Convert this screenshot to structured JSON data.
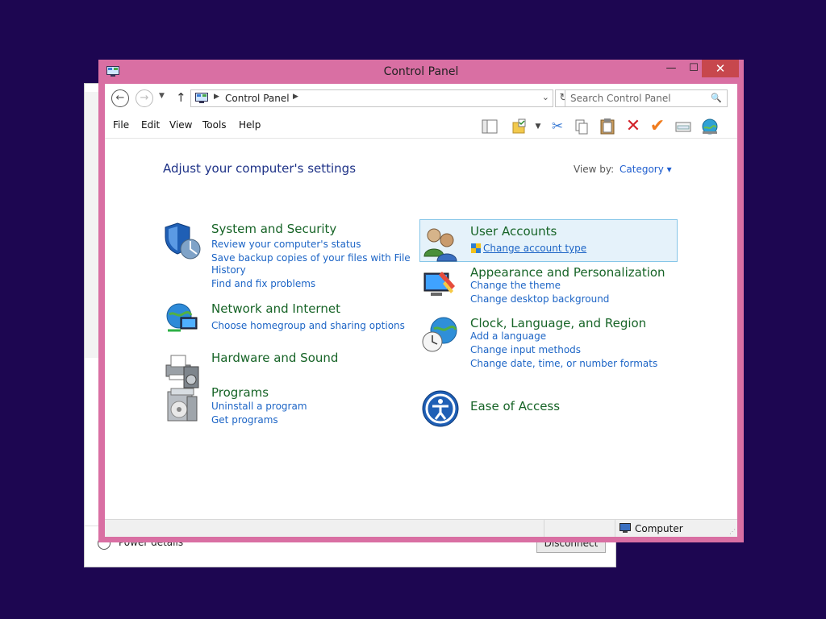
{
  "background_window": {
    "radio_label": "Power details",
    "button_label": "Disconnect"
  },
  "window": {
    "title": "Control Panel",
    "minimize_symbol": "—",
    "maximize_symbol": "☐",
    "close_symbol": "✕"
  },
  "address": {
    "path": "Control Panel",
    "search_placeholder": "Search Control Panel"
  },
  "menu": {
    "file": "File",
    "edit": "Edit",
    "view": "View",
    "tools": "Tools",
    "help": "Help"
  },
  "toolbar_icons": [
    "layout-icon",
    "folder-icon",
    "cut-icon",
    "copy-icon",
    "paste-icon",
    "delete-icon",
    "check-icon",
    "properties-icon",
    "globe-icon"
  ],
  "content": {
    "heading": "Adjust your computer's settings",
    "view_by_label": "View by:",
    "view_by_value": "Category ▾",
    "categories_left": [
      {
        "title": "System and Security",
        "links": [
          "Review your computer's status",
          "Save backup copies of your files with File",
          "History",
          "Find and fix problems"
        ]
      },
      {
        "title": "Network and Internet",
        "links": [
          "Choose homegroup and sharing options"
        ]
      },
      {
        "title": "Hardware and Sound",
        "links": []
      },
      {
        "title": "Programs",
        "links": [
          "Uninstall a program",
          "Get programs"
        ]
      }
    ],
    "categories_right": [
      {
        "title": "User Accounts",
        "links": [
          "Change account type"
        ]
      },
      {
        "title": "Appearance and Personalization",
        "links": [
          "Change the theme",
          "Change desktop background"
        ]
      },
      {
        "title": "Clock, Language, and Region",
        "links": [
          "Add a language",
          "Change input methods",
          "Change date, time, or number formats"
        ]
      },
      {
        "title": "Ease of Access",
        "links": []
      }
    ]
  },
  "statusbar": {
    "location": "Computer"
  },
  "colors": {
    "desktop": "#1d0651",
    "window_frame": "#d96fa3",
    "close_button": "#c7474d",
    "category_title": "#176427",
    "link": "#1d65c6",
    "heading": "#1e3287"
  }
}
